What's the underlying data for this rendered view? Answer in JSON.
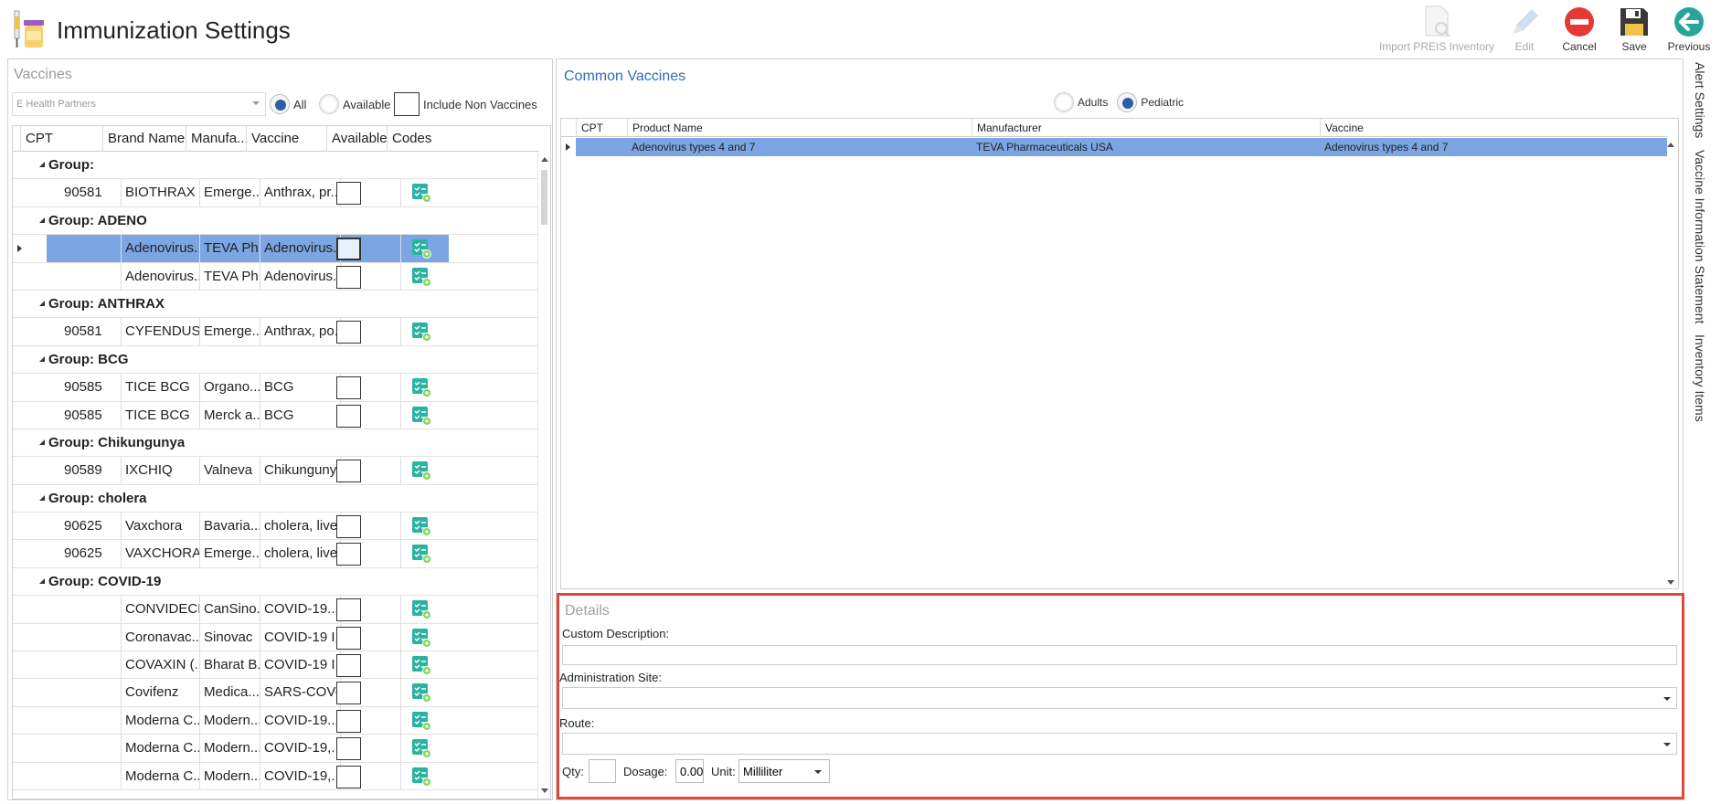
{
  "header": {
    "title": "Immunization Settings",
    "toolbar": [
      {
        "label": "Import PREIS Inventory",
        "icon": "document-search-icon",
        "enabled": false
      },
      {
        "label": "Edit",
        "icon": "pencil-icon",
        "enabled": false
      },
      {
        "label": "Cancel",
        "icon": "cancel-icon",
        "enabled": true,
        "color": "#e53935"
      },
      {
        "label": "Save",
        "icon": "floppy-disk-icon",
        "enabled": true
      },
      {
        "label": "Previous",
        "icon": "back-arrow-icon",
        "enabled": true,
        "color": "#26a69a"
      }
    ]
  },
  "vaccines": {
    "title": "Vaccines",
    "practice_select": "E Health Partners",
    "filter_all": "All",
    "filter_available": "Available",
    "include_non_vaccines": "Include Non Vaccines",
    "columns": [
      "CPT",
      "Brand Name",
      "Manufa...",
      "Vaccine",
      "Available",
      "Codes"
    ],
    "groups": [
      {
        "label": "Group:",
        "rows": [
          {
            "cpt": "90581",
            "brand": "BIOTHRAX",
            "mfr": "Emerge...",
            "vaccine": "Anthrax, pr..."
          }
        ]
      },
      {
        "label": "Group: ADENO",
        "rows": [
          {
            "cpt": "",
            "brand": "Adenovirus...",
            "mfr": "TEVA Ph...",
            "vaccine": "Adenovirus...",
            "selected": true
          },
          {
            "cpt": "",
            "brand": "Adenovirus...",
            "mfr": "TEVA Ph...",
            "vaccine": "Adenovirus..."
          }
        ]
      },
      {
        "label": "Group: ANTHRAX",
        "rows": [
          {
            "cpt": "90581",
            "brand": "CYFENDUS",
            "mfr": "Emerge...",
            "vaccine": "Anthrax, po..."
          }
        ]
      },
      {
        "label": "Group: BCG",
        "rows": [
          {
            "cpt": "90585",
            "brand": "TICE BCG",
            "mfr": "Organo...",
            "vaccine": "BCG"
          },
          {
            "cpt": "90585",
            "brand": "TICE BCG",
            "mfr": "Merck a...",
            "vaccine": "BCG"
          }
        ]
      },
      {
        "label": "Group: Chikungunya",
        "rows": [
          {
            "cpt": "90589",
            "brand": "IXCHIQ",
            "mfr": "Valneva",
            "vaccine": "Chikunguny..."
          }
        ]
      },
      {
        "label": "Group: cholera",
        "rows": [
          {
            "cpt": "90625",
            "brand": "Vaxchora",
            "mfr": "Bavaria...",
            "vaccine": "cholera, live..."
          },
          {
            "cpt": "90625",
            "brand": "VAXCHORA",
            "mfr": "Emerge...",
            "vaccine": "cholera, live..."
          }
        ]
      },
      {
        "label": "Group: COVID-19",
        "rows": [
          {
            "cpt": "",
            "brand": "CONVIDECI...",
            "mfr": "CanSino...",
            "vaccine": "COVID-19..."
          },
          {
            "cpt": "",
            "brand": "Coronavac...",
            "mfr": "Sinovac",
            "vaccine": "COVID-19 I..."
          },
          {
            "cpt": "",
            "brand": "COVAXIN (...",
            "mfr": "Bharat B...",
            "vaccine": "COVID-19 I..."
          },
          {
            "cpt": "",
            "brand": "Covifenz",
            "mfr": "Medica...",
            "vaccine": "SARS-COV-..."
          },
          {
            "cpt": "",
            "brand": "Moderna C...",
            "mfr": "Modern...",
            "vaccine": "COVID-19..."
          },
          {
            "cpt": "",
            "brand": "Moderna C...",
            "mfr": "Modern...",
            "vaccine": "COVID-19,..."
          },
          {
            "cpt": "",
            "brand": "Moderna C...",
            "mfr": "Modern...",
            "vaccine": "COVID-19,..."
          }
        ]
      }
    ]
  },
  "common_vaccines": {
    "title": "Common Vaccines",
    "opt_adults": "Adults",
    "opt_pediatric": "Pediatric",
    "columns": [
      "CPT",
      "Product Name",
      "Manufacturer",
      "Vaccine"
    ],
    "rows": [
      {
        "cpt": "",
        "product": "Adenovirus types 4 and 7",
        "manufacturer": "TEVA Pharmaceuticals USA",
        "vaccine": "Adenovirus types 4 and 7"
      }
    ]
  },
  "details": {
    "title": "Details",
    "custom_description_label": "Custom Description:",
    "custom_description_value": "",
    "admin_site_label": "Administration Site:",
    "admin_site_value": "",
    "route_label": "Route:",
    "route_value": "",
    "qty_label": "Qty:",
    "qty_value": "",
    "dosage_label": "Dosage:",
    "dosage_value": "0.00",
    "unit_label": "Unit:",
    "unit_value": "Milliliter"
  },
  "side_tabs": [
    "Alert Settings",
    "Vaccine Information Statement",
    "Inventory Items"
  ],
  "colors": {
    "selection": "#7ba6e3",
    "accent": "#2e6db7",
    "highlight_border": "#e0473a"
  }
}
